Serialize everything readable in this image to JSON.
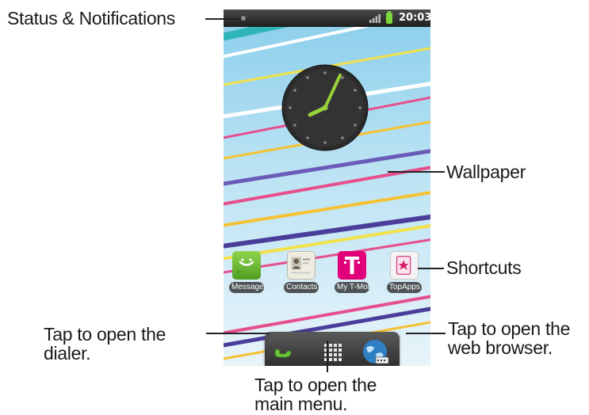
{
  "callouts": {
    "status": "Status & Notifications",
    "wallpaper": "Wallpaper",
    "shortcuts": "Shortcuts",
    "dialer_line1": "Tap to open the",
    "dialer_line2": "dialer.",
    "browser_line1": "Tap to open the",
    "browser_line2": "web browser.",
    "menu_line1": "Tap to open the",
    "menu_line2": "main menu."
  },
  "status_bar": {
    "time": "20:03",
    "icons": [
      "notification-dot-icon",
      "signal-icon",
      "battery-icon"
    ]
  },
  "shortcuts": [
    {
      "label": "Messages",
      "icon": "messages-icon",
      "color": "#6cbf3a"
    },
    {
      "label": "Contacts",
      "icon": "contacts-icon",
      "color": "#e9e6dc"
    },
    {
      "label": "My T-Mobi",
      "icon": "tmobile-icon",
      "color": "#e2007a"
    },
    {
      "label": "TopApps",
      "icon": "topapps-icon",
      "color": "#f2f2f2"
    }
  ],
  "dock": {
    "icons": [
      "phone-icon",
      "app-grid-icon",
      "globe-icon"
    ]
  },
  "colors": {
    "accent_green": "#9ad13a",
    "tmobile_magenta": "#e2007a",
    "status_bar": "#2a2a2a"
  }
}
